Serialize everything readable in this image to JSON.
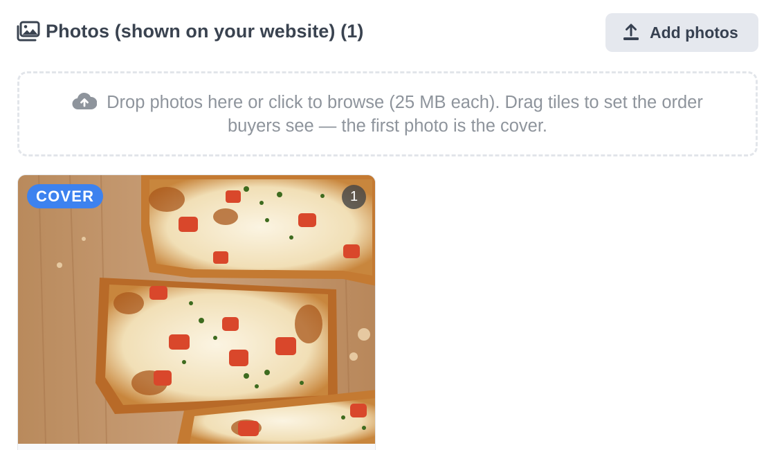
{
  "section": {
    "title": "Photos (shown on your website) (1)",
    "title_icon": "images-icon"
  },
  "toolbar": {
    "add_label": "Add photos",
    "add_icon": "upload-icon"
  },
  "dropzone": {
    "icon": "cloud-upload-icon",
    "text": "Drop photos here or click to browse (25 MB each). Drag tiles to set the order buyers see — the first photo is the cover."
  },
  "photos": [
    {
      "badge": "COVER",
      "position": "1",
      "subject": "pizza-photo"
    }
  ],
  "colors": {
    "accent": "#3d82ef",
    "button_bg": "#e5e8ee",
    "dropzone_border": "#e2e5ea",
    "muted_text": "#8e949c"
  }
}
